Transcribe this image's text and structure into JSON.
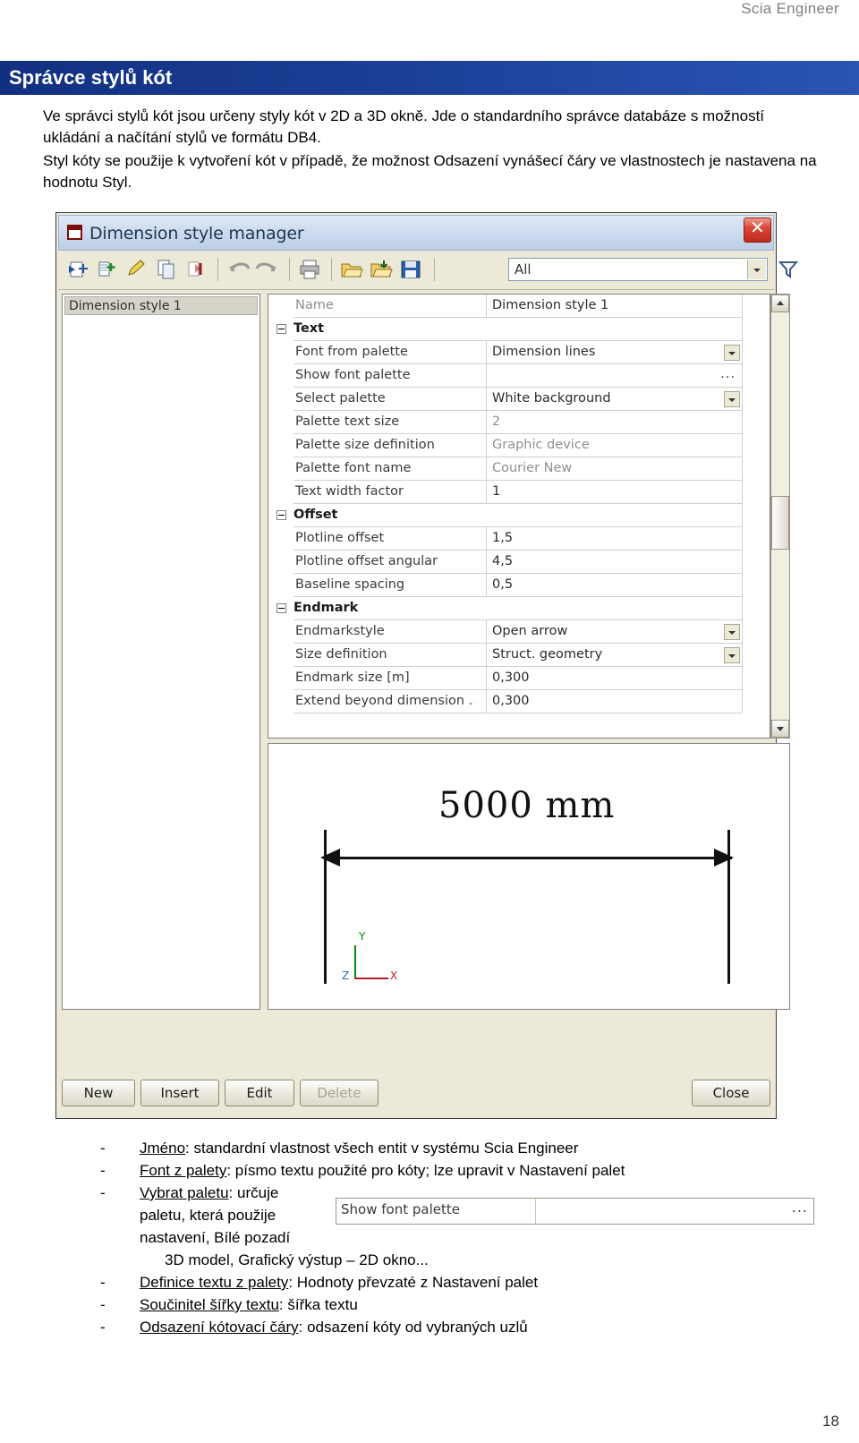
{
  "header": {
    "brand": "Scia Engineer",
    "page_title": "Správce stylů kót",
    "page_number": "18"
  },
  "intro": {
    "p1": "Ve správci stylů kót jsou určeny styly kót v 2D a 3D okně. Jde o standardního správce databáze s možností ukládání a načítání stylů ve formátu DB4.",
    "p2": "Styl kóty se použije k vytvoření kót v případě, že možnost Odsazení vynášecí čáry ve vlastnostech je nastavena na hodnotu Styl."
  },
  "dialog": {
    "title": "Dimension style manager",
    "close_label": "✕",
    "toolbar": {
      "filter_value": "All",
      "buttons": [
        "insert-new-icon",
        "insert-multiple-icon",
        "edit-icon",
        "copy-icon",
        "delete-icon",
        "undo-icon",
        "redo-icon",
        "print-icon",
        "open-folder-icon",
        "import-folder-icon",
        "save-icon"
      ],
      "filter_icon": "funnel-icon"
    },
    "left_pane": {
      "items": [
        "Dimension style 1"
      ]
    },
    "grid": {
      "rows": [
        {
          "type": "header",
          "label": "Name",
          "value": "Dimension style 1",
          "control": "none"
        },
        {
          "type": "group",
          "label": "Text",
          "value": "",
          "control": "none"
        },
        {
          "type": "prop",
          "label": "Font from palette",
          "value": "Dimension lines",
          "control": "dropdown"
        },
        {
          "type": "prop",
          "label": "Show font palette",
          "value": "",
          "control": "dots"
        },
        {
          "type": "prop",
          "label": "Select palette",
          "value": "White background",
          "control": "dropdown"
        },
        {
          "type": "prop",
          "label": "Palette text size",
          "value": "2",
          "control": "readonly"
        },
        {
          "type": "prop",
          "label": "Palette size definition",
          "value": "Graphic device",
          "control": "readonly"
        },
        {
          "type": "prop",
          "label": "Palette font name",
          "value": "Courier New",
          "control": "readonly"
        },
        {
          "type": "prop",
          "label": "Text width factor",
          "value": "1",
          "control": "none"
        },
        {
          "type": "group",
          "label": "Offset",
          "value": "",
          "control": "none"
        },
        {
          "type": "prop",
          "label": "Plotline offset",
          "value": "1,5",
          "control": "none"
        },
        {
          "type": "prop",
          "label": "Plotline offset angular",
          "value": "4,5",
          "control": "none"
        },
        {
          "type": "prop",
          "label": "Baseline spacing",
          "value": "0,5",
          "control": "none"
        },
        {
          "type": "group",
          "label": "Endmark",
          "value": "",
          "control": "none"
        },
        {
          "type": "prop",
          "label": "Endmarkstyle",
          "value": "Open arrow",
          "control": "dropdown"
        },
        {
          "type": "prop",
          "label": "Size definition",
          "value": "Struct. geometry",
          "control": "dropdown"
        },
        {
          "type": "prop",
          "label": "Endmark size [m]",
          "value": "0,300",
          "control": "none"
        },
        {
          "type": "prop",
          "label": "Extend beyond dimension ...",
          "value": "0,300",
          "control": "none"
        }
      ]
    },
    "preview": {
      "dimension_text": "5000 mm",
      "axis_y": "Y",
      "axis_x": "X",
      "axis_z": "Z"
    },
    "buttons": {
      "new": "New",
      "insert": "Insert",
      "edit": "Edit",
      "delete": "Delete",
      "close": "Close"
    }
  },
  "inline_shot": {
    "label": "Show font palette",
    "dots": "..."
  },
  "bullets": [
    {
      "dash": "-",
      "term": "Jméno",
      "rest": ": standardní vlastnost všech entit v systému Scia Engineer"
    },
    {
      "dash": "-",
      "term": "Font z palety",
      "rest": ": písmo textu použité pro kóty; lze upravit v Nastavení palet"
    },
    {
      "dash": "-",
      "term": "Vybrat paletu",
      "rest": ": určuje"
    },
    {
      "dash": "-",
      "term": "Definice textu z palety",
      "rest": ": Hodnoty převzaté z Nastavení palet"
    },
    {
      "dash": "-",
      "term": "Součinitel šířky textu",
      "rest": ": šířka textu"
    },
    {
      "dash": "-",
      "term": "Odsazení kótovací čáry",
      "rest": ": odsazení kóty od vybraných uzlů"
    }
  ],
  "bullet_wrap": {
    "line1": "paletu, která použije",
    "line2": "nastavení, Bílé pozadí",
    "line3": "3D model, Grafický výstup – 2D okno..."
  },
  "colors": {
    "title_bar": "#1f3c8c",
    "brand_text": "#7f7f7f",
    "dialog_face": "#ece9d8"
  }
}
